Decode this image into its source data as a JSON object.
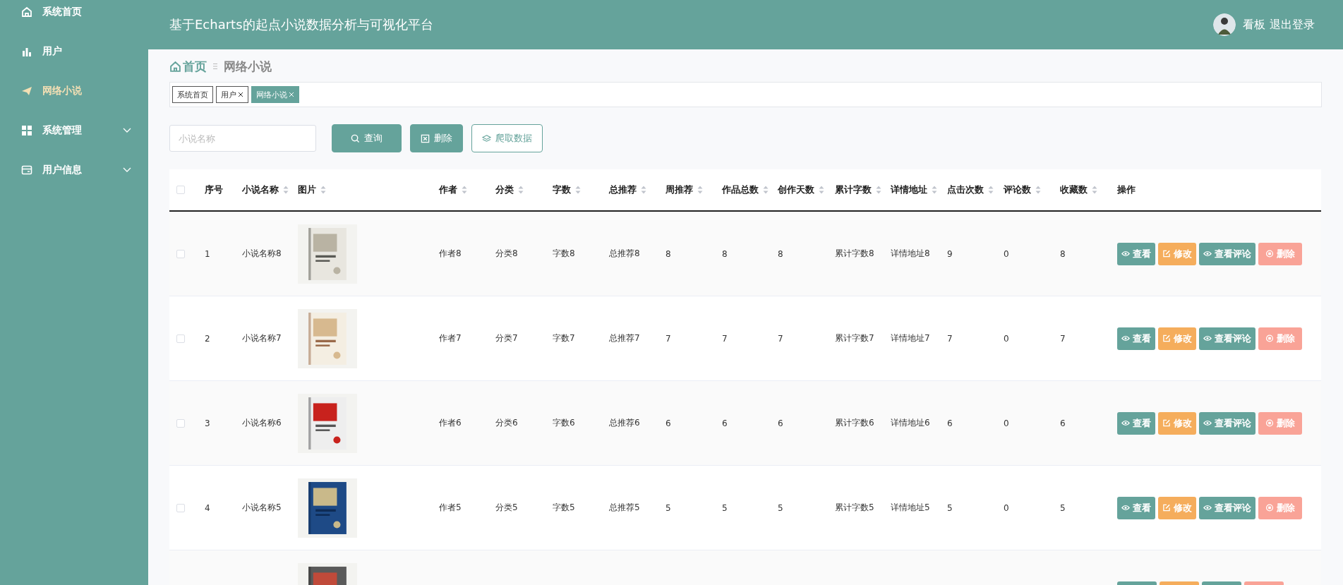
{
  "sidebar": {
    "items": [
      {
        "label": "系统首页",
        "selected": false,
        "expandable": false
      },
      {
        "label": "用户",
        "selected": false,
        "expandable": false
      },
      {
        "label": "网络小说",
        "selected": true,
        "expandable": false
      },
      {
        "label": "系统管理",
        "selected": false,
        "expandable": true
      },
      {
        "label": "用户信息",
        "selected": false,
        "expandable": true
      }
    ]
  },
  "header": {
    "title": "基于Echarts的起点小说数据分析与可视化平台",
    "user": "看板",
    "logout": "退出登录"
  },
  "breadcrumb": {
    "home": "首页",
    "current": "网络小说"
  },
  "tags": [
    {
      "label": "系统首页",
      "closable": false,
      "selected": false
    },
    {
      "label": "用户",
      "closable": true,
      "selected": false
    },
    {
      "label": "网络小说",
      "closable": true,
      "selected": true
    }
  ],
  "search": {
    "placeholder": "小说名称"
  },
  "toolbar": [
    {
      "label": "查询",
      "kind": "search"
    },
    {
      "label": "删除",
      "kind": "delete"
    },
    {
      "label": "爬取数据",
      "kind": "crawl"
    }
  ],
  "table": {
    "all_checked": false,
    "columns": [
      {
        "label": "序号",
        "sortable": false
      },
      {
        "label": "小说名称",
        "sortable": true
      },
      {
        "label": "图片",
        "sortable": true
      },
      {
        "label": "作者",
        "sortable": true
      },
      {
        "label": "分类",
        "sortable": true
      },
      {
        "label": "字数",
        "sortable": true
      },
      {
        "label": "总推荐",
        "sortable": true
      },
      {
        "label": "周推荐",
        "sortable": true
      },
      {
        "label": "作品总数",
        "sortable": true
      },
      {
        "label": "创作天数",
        "sortable": true
      },
      {
        "label": "累计字数",
        "sortable": true
      },
      {
        "label": "详情地址",
        "sortable": true
      },
      {
        "label": "点击次数",
        "sortable": true
      },
      {
        "label": "评论数",
        "sortable": true
      },
      {
        "label": "收藏数",
        "sortable": true
      },
      {
        "label": "操作",
        "sortable": false
      }
    ],
    "rows": [
      {
        "checked": false,
        "cells": [
          "1",
          "小说名称8",
          "作者8",
          "分类8",
          "字数8",
          "总推荐8",
          "8",
          "8",
          "8",
          "累计字数8",
          "详情地址8",
          "9",
          "0",
          "8"
        ],
        "actions": [
          {
            "label": "查看",
            "kind": "view"
          },
          {
            "label": "修改",
            "kind": "edit"
          },
          {
            "label": "查看评论",
            "kind": "view"
          },
          {
            "label": "删除",
            "kind": "delete"
          }
        ]
      },
      {
        "checked": false,
        "cells": [
          "2",
          "小说名称7",
          "作者7",
          "分类7",
          "字数7",
          "总推荐7",
          "7",
          "7",
          "7",
          "累计字数7",
          "详情地址7",
          "7",
          "0",
          "7"
        ],
        "actions": [
          {
            "label": "查看",
            "kind": "view"
          },
          {
            "label": "修改",
            "kind": "edit"
          },
          {
            "label": "查看评论",
            "kind": "view"
          },
          {
            "label": "删除",
            "kind": "delete"
          }
        ]
      },
      {
        "checked": false,
        "cells": [
          "3",
          "小说名称6",
          "作者6",
          "分类6",
          "字数6",
          "总推荐6",
          "6",
          "6",
          "6",
          "累计字数6",
          "详情地址6",
          "6",
          "0",
          "6"
        ],
        "actions": [
          {
            "label": "查看",
            "kind": "view"
          },
          {
            "label": "修改",
            "kind": "edit"
          },
          {
            "label": "查看评论",
            "kind": "view"
          },
          {
            "label": "删除",
            "kind": "delete"
          }
        ]
      },
      {
        "checked": false,
        "cells": [
          "4",
          "小说名称5",
          "作者5",
          "分类5",
          "字数5",
          "总推荐5",
          "5",
          "5",
          "5",
          "累计字数5",
          "详情地址5",
          "5",
          "0",
          "5"
        ],
        "actions": [
          {
            "label": "查看",
            "kind": "view"
          },
          {
            "label": "修改",
            "kind": "edit"
          },
          {
            "label": "查看评论",
            "kind": "view"
          },
          {
            "label": "删除",
            "kind": "delete"
          }
        ]
      },
      {
        "actions": [
          {
            "kind": "view"
          },
          {
            "kind": "edit"
          },
          {
            "kind": "view"
          },
          {
            "kind": "delete"
          }
        ]
      }
    ]
  }
}
